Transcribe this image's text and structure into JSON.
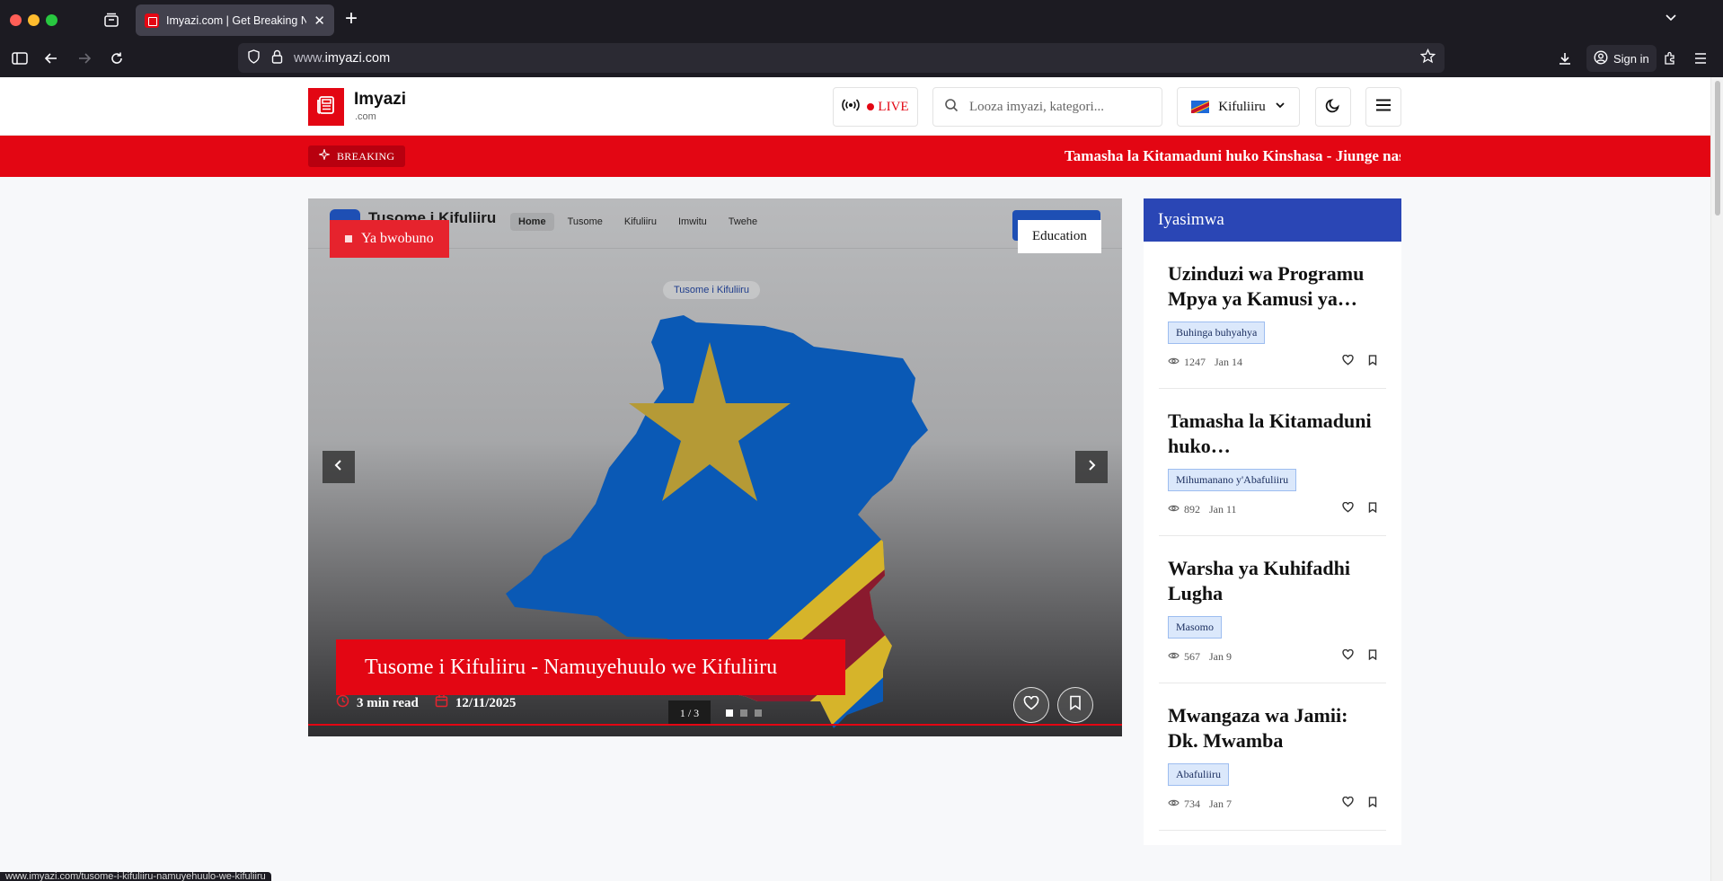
{
  "browser": {
    "tab_title": "Imyazi.com | Get Breaking News",
    "url_prefix": "www.",
    "url_domain": "imyazi.com",
    "signin_label": "Sign in",
    "status_url": "www.imyazi.com/tusome-i-kifuliiru-namuyehuulo-we-kifuliiru"
  },
  "header": {
    "logo_name": "Imyazi",
    "logo_sub": ".com",
    "live_label": "LIVE",
    "search_placeholder": "Looza imyazi, kategori...",
    "language_label": "Kifuliiru"
  },
  "breaking": {
    "label": "BREAKING",
    "ticker": "Tamasha la Kitamaduni huko Kinshasa - Jiunge nasi"
  },
  "hero": {
    "badge_left": "Ya bwobuno",
    "badge_right": "Education",
    "title": "Tusome i Kifuliiru - Namuyehuulo we Kifuliiru",
    "read_time": "3 min read",
    "date": "12/11/2025",
    "counter": "1 / 3",
    "slides_total": 3,
    "slide_active": 1,
    "inner_site_title": "Tusome i Kifuliiru",
    "inner_pill": "Tusome i Kifuliiru",
    "inner_menu": [
      "Home",
      "Tusome",
      "Kifuliiru",
      "Imwitu",
      "Twehe"
    ]
  },
  "sidebar": {
    "title": "Iyasimwa",
    "items": [
      {
        "title": "Uzinduzi wa Programu Mpya ya Kamusi ya…",
        "tag": "Buhinga buhyahya",
        "views": "1247",
        "date": "Jan 14"
      },
      {
        "title": "Tamasha la Kitamaduni huko…",
        "tag": "Mihumanano y'Abafuliiru",
        "views": "892",
        "date": "Jan 11"
      },
      {
        "title": "Warsha ya Kuhifadhi Lugha",
        "tag": "Masomo",
        "views": "567",
        "date": "Jan 9"
      },
      {
        "title": "Mwangaza wa Jamii: Dk. Mwamba",
        "tag": "Abafuliiru",
        "views": "734",
        "date": "Jan 7"
      }
    ]
  },
  "colors": {
    "brand_red": "#e30613",
    "sidebar_blue": "#2a46b5",
    "tag_bg": "#dbe8fb"
  },
  "icons": [
    "tabs-icon",
    "sidebar-icon",
    "back-icon",
    "forward-icon",
    "reload-icon",
    "shield-icon",
    "lock-icon",
    "star-icon",
    "download-icon",
    "account-icon",
    "extensions-icon",
    "menu-icon",
    "newspaper-icon",
    "broadcast-icon",
    "search-icon",
    "chevron-down-icon",
    "moon-icon",
    "hamburger-icon",
    "sparkle-icon",
    "chevron-left-icon",
    "chevron-right-icon",
    "clock-icon",
    "calendar-icon",
    "heart-icon",
    "bookmark-icon",
    "eye-icon"
  ]
}
